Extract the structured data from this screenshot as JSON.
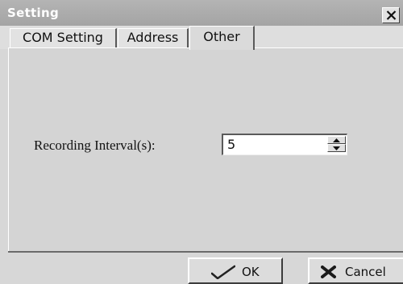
{
  "window": {
    "title": "Setting",
    "close_icon": "close-icon"
  },
  "tabs": [
    {
      "label": "COM Setting",
      "active": false
    },
    {
      "label": "Address",
      "active": false
    },
    {
      "label": "Other",
      "active": true
    }
  ],
  "other_tab": {
    "recording_interval": {
      "label": "Recording Interval(s):",
      "value": "5"
    }
  },
  "buttons": {
    "ok_label": "OK",
    "ok_icon": "checkmark-icon",
    "cancel_label": "Cancel",
    "cancel_icon": "cross-icon"
  }
}
